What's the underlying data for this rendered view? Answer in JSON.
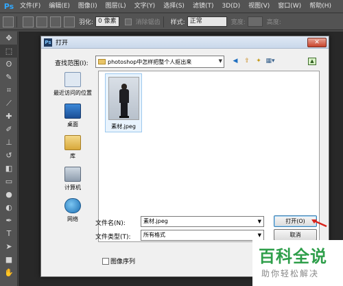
{
  "menubar": {
    "logo": "Ps",
    "items": [
      "文件(F)",
      "编辑(E)",
      "图像(I)",
      "图层(L)",
      "文字(Y)",
      "选择(S)",
      "滤镜(T)",
      "3D(D)",
      "视图(V)",
      "窗口(W)",
      "帮助(H)"
    ]
  },
  "options": {
    "feather_label": "羽化:",
    "feather_value": "0 像素",
    "antialias_label": "消除锯齿",
    "style_label": "样式:",
    "style_value": "正常",
    "width_label": "宽度:",
    "height_label": "高度:"
  },
  "dialog": {
    "title_icon": "Ps",
    "title": "打开",
    "close": "✕",
    "lookin_label": "查找范围(I):",
    "lookin_value": "photoshop中怎样把整个人抠出来",
    "places": [
      {
        "label": "最近访问的位置"
      },
      {
        "label": "桌面"
      },
      {
        "label": "库"
      },
      {
        "label": "计算机"
      },
      {
        "label": "网络"
      }
    ],
    "file": {
      "name": "素材.jpeg"
    },
    "filename_label": "文件名(N):",
    "filename_value": "素材.jpeg",
    "filetype_label": "文件类型(T):",
    "filetype_value": "所有格式",
    "open_button": "打开(O)",
    "cancel_button": "取消",
    "preview_label": "图像序列"
  },
  "watermark": {
    "main": "百科全说",
    "sub": "助你轻松解决"
  },
  "colors": {
    "ps_blue": "#31a8ff",
    "watermark_green": "#2e9e4a",
    "arrow_red": "#d9241c"
  }
}
